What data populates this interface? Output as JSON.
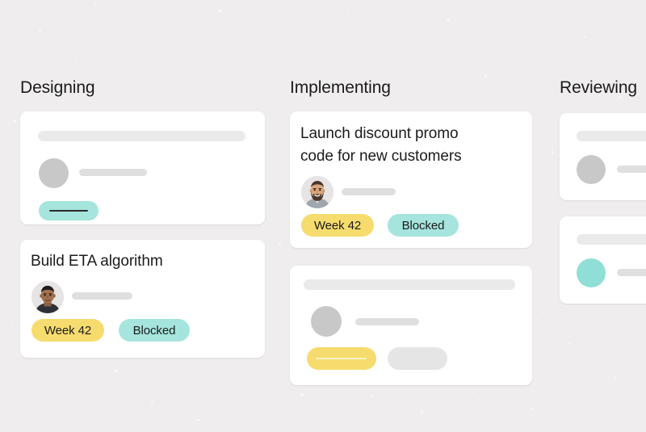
{
  "board": {
    "background_color": "#EFEDED",
    "columns": [
      {
        "id": "designing",
        "title": "Designing",
        "cards": [
          {
            "id": "designing-card-1",
            "type": "placeholder",
            "title": "",
            "avatar": "gray-circle-avatar",
            "tags": [
              {
                "label": "",
                "color": "#A5E5DD",
                "type": "placeholder"
              }
            ]
          },
          {
            "id": "designing-card-2",
            "type": "content",
            "title": "Build ETA algorithm",
            "avatar": "photo-avatar-dark-shirt",
            "tags": [
              {
                "label": "Week 42",
                "color": "#F6DC6E",
                "type": "text"
              },
              {
                "label": "Blocked",
                "color": "#A5E5DD",
                "type": "text"
              }
            ]
          }
        ]
      },
      {
        "id": "implementing",
        "title": "Implementing",
        "cards": [
          {
            "id": "implementing-card-1",
            "type": "content",
            "title": "Launch discount promo code for new customers",
            "title_line_1": "Launch discount promo",
            "title_line_2": "code for new customers",
            "avatar": "photo-avatar-bearded-man",
            "tags": [
              {
                "label": "Week 42",
                "color": "#F6DC6E",
                "type": "text"
              },
              {
                "label": "Blocked",
                "color": "#A5E5DD",
                "type": "text"
              }
            ]
          },
          {
            "id": "implementing-card-2",
            "type": "placeholder",
            "title": "",
            "avatar": "gray-circle-avatar",
            "tags": [
              {
                "label": "",
                "color": "#F6DC6E",
                "type": "placeholder"
              },
              {
                "label": "",
                "color": "#E6E5E5",
                "type": "placeholder"
              }
            ]
          }
        ]
      },
      {
        "id": "reviewing",
        "title": "Reviewing",
        "cards": [
          {
            "id": "reviewing-card-1",
            "type": "placeholder",
            "title": "",
            "avatar": "gray-circle-avatar",
            "tags": []
          },
          {
            "id": "reviewing-card-2",
            "type": "placeholder",
            "title": "",
            "avatar": "teal-circle-avatar",
            "tags": []
          }
        ]
      }
    ]
  },
  "colors": {
    "background": "#EFEDED",
    "card": "#FFFFFF",
    "accent_yellow": "#F6DC6E",
    "accent_teal": "#A5E5DD",
    "avatar_teal": "#8FDFD6",
    "skeleton_bar": "#EBEAEA",
    "skeleton_line": "#E0DFDF",
    "skeleton_avatar": "#C9C8C8",
    "skeleton_pill_gray": "#E6E5E5",
    "text": "#1B1B1B"
  }
}
